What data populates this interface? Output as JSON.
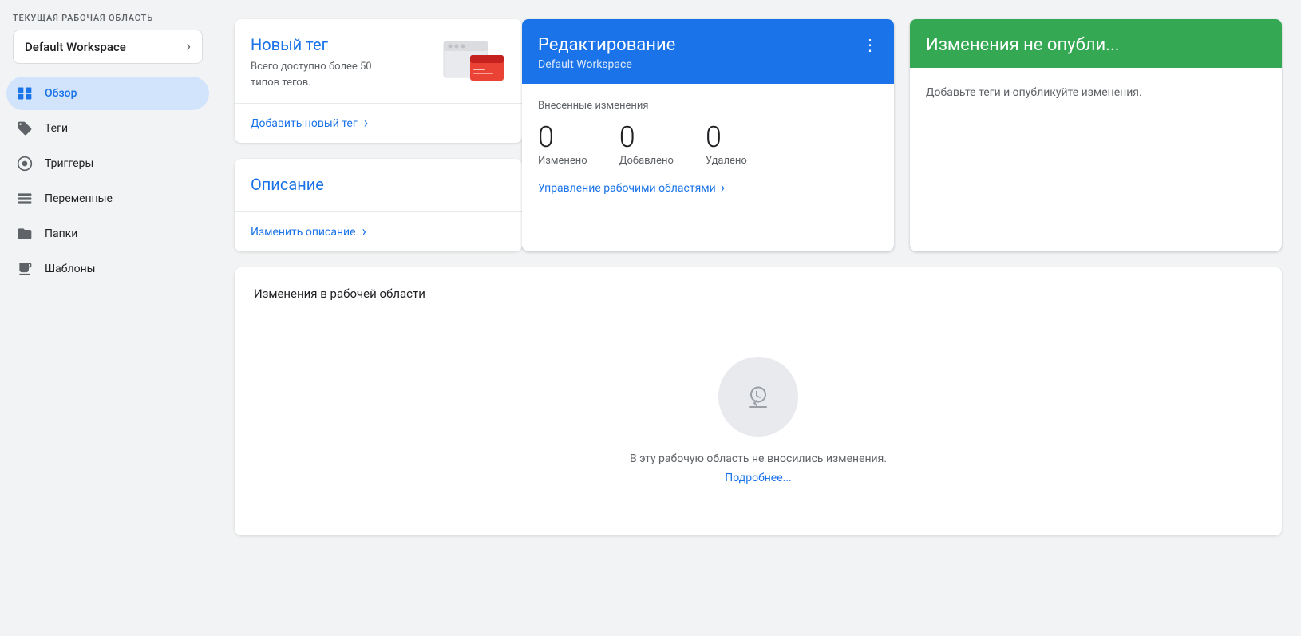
{
  "sidebar": {
    "workspace_label": "ТЕКУЩАЯ РАБОЧАЯ ОБЛАСТЬ",
    "workspace_name": "Default Workspace",
    "workspace_arrow": "›",
    "nav_items": [
      {
        "id": "overview",
        "label": "Обзор",
        "active": true,
        "icon": "overview-icon"
      },
      {
        "id": "tags",
        "label": "Теги",
        "active": false,
        "icon": "tag-icon"
      },
      {
        "id": "triggers",
        "label": "Триггеры",
        "active": false,
        "icon": "trigger-icon"
      },
      {
        "id": "variables",
        "label": "Переменные",
        "active": false,
        "icon": "variable-icon"
      },
      {
        "id": "folders",
        "label": "Папки",
        "active": false,
        "icon": "folder-icon"
      },
      {
        "id": "templates",
        "label": "Шаблоны",
        "active": false,
        "icon": "template-icon"
      }
    ]
  },
  "new_tag_card": {
    "title": "Новый тег",
    "description": "Всего доступно более 50 типов тегов.",
    "link_label": "Добавить новый тег"
  },
  "description_card": {
    "title": "Описание",
    "link_label": "Изменить описание"
  },
  "editing_card": {
    "title": "Редактирование",
    "subtitle": "Default Workspace",
    "changes_label": "Внесенные изменения",
    "stats": [
      {
        "number": "0",
        "label": "Изменено"
      },
      {
        "number": "0",
        "label": "Добавлено"
      },
      {
        "number": "0",
        "label": "Удалено"
      }
    ],
    "manage_label": "Управление рабочими областями",
    "dots": "⋮"
  },
  "publish_card": {
    "title": "Изменения не опубли...",
    "description": "Добавьте теги и опубликуйте изменения."
  },
  "workspace_changes": {
    "title": "Изменения в рабочей области",
    "empty_text": "В эту рабочую область не вносились изменения.",
    "empty_link": "Подробнее..."
  },
  "colors": {
    "blue": "#1a73e8",
    "green": "#34a853",
    "sidebar_active_bg": "#d2e3fc",
    "icon_color": "#5f6368"
  }
}
